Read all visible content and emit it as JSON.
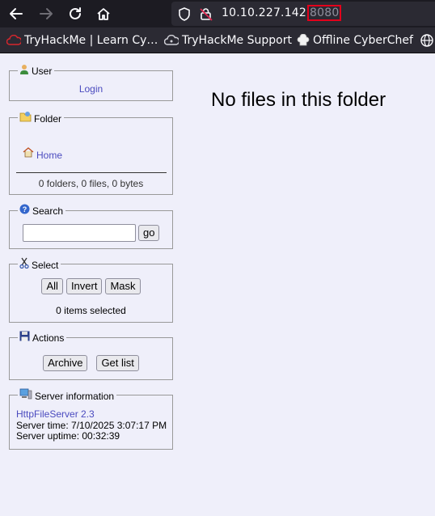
{
  "browser": {
    "url_host": "10.10.227.142",
    "url_port": "8080",
    "icons": [
      "back-arrow-icon",
      "forward-arrow-icon",
      "reload-icon",
      "home-icon",
      "shield-icon",
      "insecure-lock-icon"
    ],
    "bookmarks": [
      {
        "label": "TryHackMe | Learn Cy…",
        "icon": "tryhackme-icon"
      },
      {
        "label": "TryHackMe Support",
        "icon": "cloud-icon"
      },
      {
        "label": "Offline CyberChef",
        "icon": "chef-hat-icon"
      },
      {
        "label": "",
        "icon": "globe-icon"
      }
    ]
  },
  "sidebar": {
    "user": {
      "legend": "User",
      "login_label": "Login",
      "icon": "user-icon"
    },
    "folder": {
      "legend": "Folder",
      "home_label": "Home",
      "stats": "0 folders, 0 files, 0 bytes",
      "icon": "folder-icon"
    },
    "search": {
      "legend": "Search",
      "input_value": "",
      "go_label": "go",
      "icon": "help-icon"
    },
    "select": {
      "legend": "Select",
      "all_label": "All",
      "invert_label": "Invert",
      "mask_label": "Mask",
      "status": "0 items selected",
      "icon": "scissors-icon"
    },
    "actions": {
      "legend": "Actions",
      "archive_label": "Archive",
      "getlist_label": "Get list",
      "icon": "floppy-disk-icon"
    },
    "server": {
      "legend": "Server information",
      "product": "HttpFileServer 2.3",
      "server_time": "Server time: 7/10/2025 3:07:17 PM",
      "uptime": "Server uptime: 00:32:39",
      "icon": "server-icon"
    }
  },
  "main": {
    "message": "No files in this folder"
  }
}
